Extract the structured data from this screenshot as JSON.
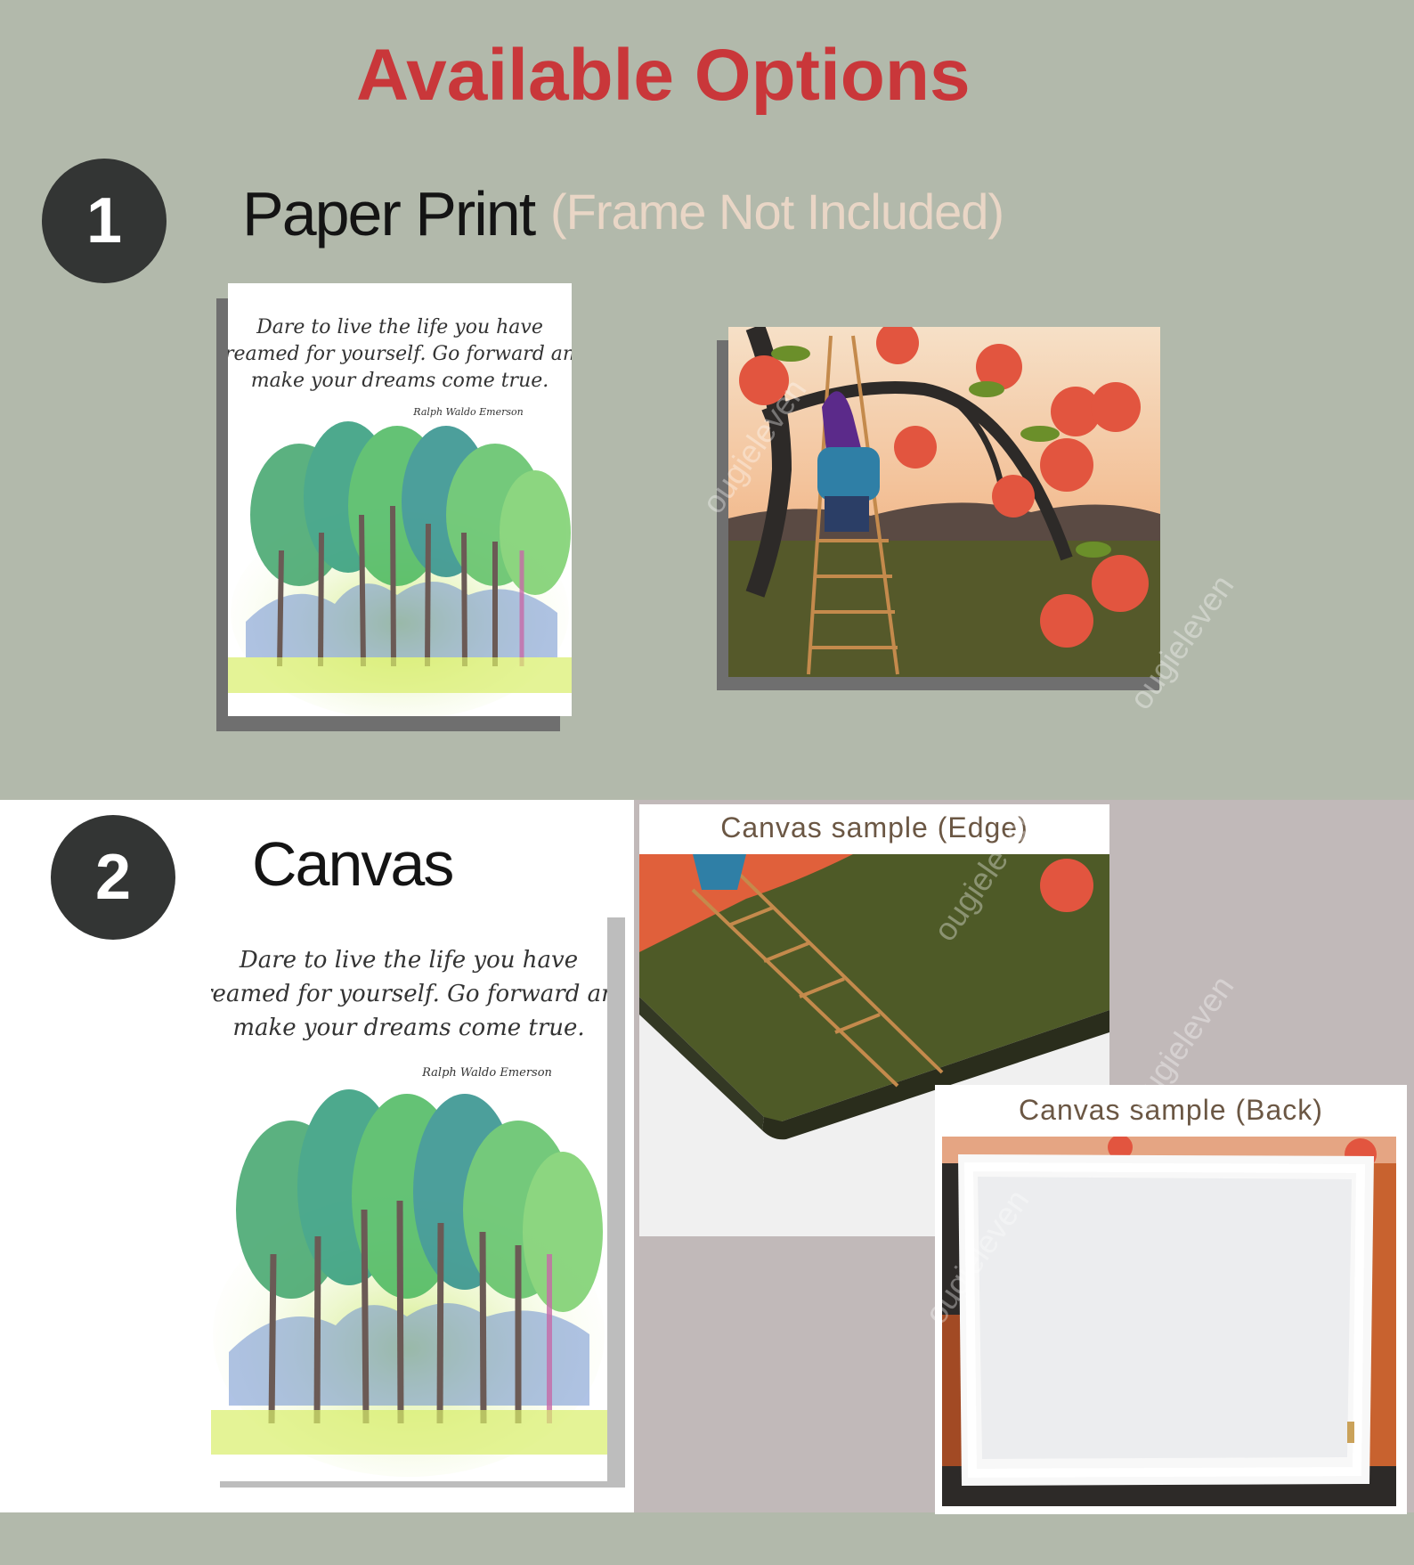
{
  "header": {
    "title": "Available Options"
  },
  "options": [
    {
      "number": "1",
      "label": "Paper Print",
      "note": "(Frame Not Included)"
    },
    {
      "number": "2",
      "label": "Canvas"
    }
  ],
  "samples": {
    "edge_label": "Canvas sample (Edge)",
    "back_label": "Canvas sample (Back)"
  },
  "watermark": "ougieleven",
  "colors": {
    "title": "#c9373a",
    "background_top": "#b2b9ab",
    "badge": "#333534",
    "note": "#e9d6c6"
  }
}
